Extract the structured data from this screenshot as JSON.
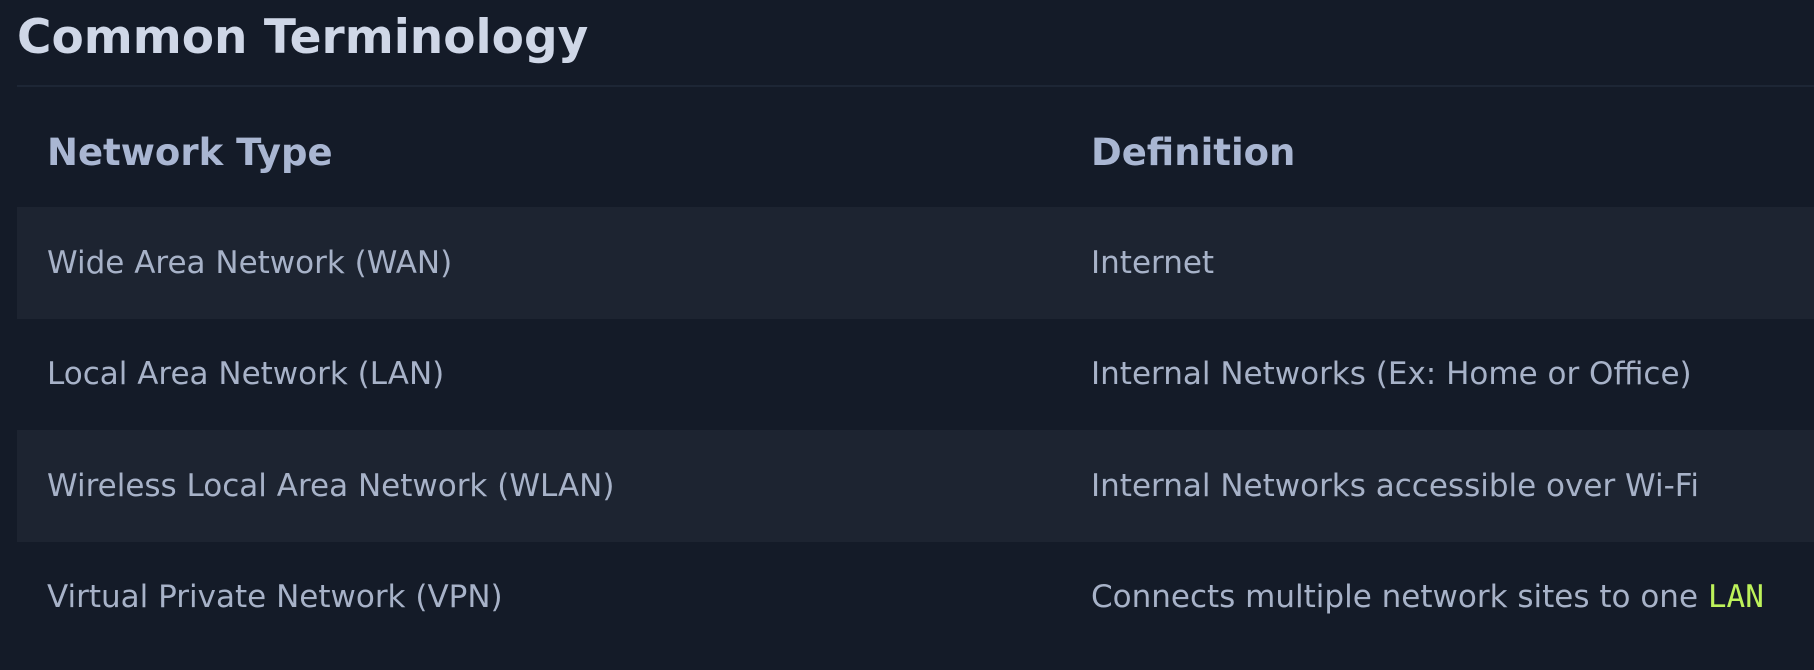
{
  "title": "Common Terminology",
  "table": {
    "headers": [
      "Network Type",
      "Definition"
    ],
    "rows": [
      {
        "network_type": "Wide Area Network (WAN)",
        "definition": "Internet",
        "definition_code": ""
      },
      {
        "network_type": "Local Area Network (LAN)",
        "definition": "Internal Networks (Ex: Home or Office)",
        "definition_code": ""
      },
      {
        "network_type": "Wireless Local Area Network (WLAN)",
        "definition": "Internal Networks accessible over Wi-Fi",
        "definition_code": ""
      },
      {
        "network_type": "Virtual Private Network (VPN)",
        "definition": "Connects multiple network sites to one ",
        "definition_code": "LAN"
      }
    ]
  },
  "colors": {
    "background": "#141b28",
    "row_alt": "#1d2431",
    "text": "#a7b2c8",
    "title": "#cfd7e7",
    "code": "#bdf25a"
  }
}
